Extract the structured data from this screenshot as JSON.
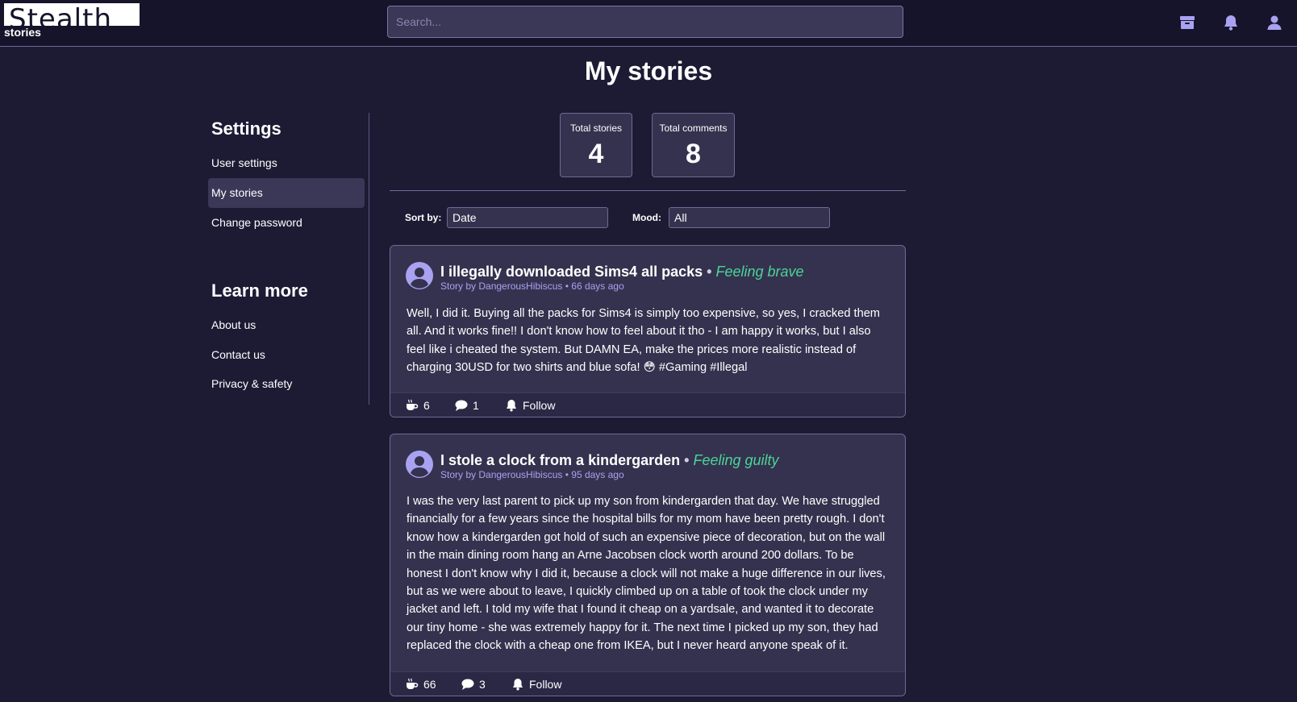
{
  "header": {
    "logo_word": "Stealth",
    "logo_sub": "stories",
    "search_placeholder": "Search...",
    "icons": [
      "archive-icon",
      "bell-icon",
      "user-icon"
    ]
  },
  "page": {
    "title": "My stories"
  },
  "sidebar": {
    "settings_heading": "Settings",
    "settings_items": [
      {
        "label": "User settings",
        "active": false
      },
      {
        "label": "My stories",
        "active": true
      },
      {
        "label": "Change password",
        "active": false
      }
    ],
    "learn_heading": "Learn more",
    "learn_items": [
      {
        "label": "About us"
      },
      {
        "label": "Contact us"
      },
      {
        "label": "Privacy & safety"
      }
    ]
  },
  "stats": {
    "total_stories_label": "Total stories",
    "total_stories": "4",
    "total_comments_label": "Total comments",
    "total_comments": "8"
  },
  "filters": {
    "sort_label": "Sort by:",
    "sort_value": "Date",
    "mood_label": "Mood:",
    "mood_value": "All"
  },
  "stories": [
    {
      "title": "I illegally downloaded Sims4 all packs",
      "separator": "•",
      "mood": "Feeling brave",
      "meta": "Story by DangerousHibiscus • 66 days ago",
      "body": "Well, I did it. Buying all the packs for Sims4 is simply too expensive, so yes, I cracked them all. And it works fine!! I don't know how to feel about it tho - I am happy it works, but I also feel like i cheated the system. But DAMN EA, make the prices more realistic instead of charging 30USD for two shirts and blue sofa! 😳 #Gaming #Illegal",
      "likes": "6",
      "comments": "1",
      "follow": "Follow"
    },
    {
      "title": "I stole a clock from a kindergarden",
      "separator": "•",
      "mood": "Feeling guilty",
      "meta": "Story by DangerousHibiscus • 95 days ago",
      "body": "I was the very last parent to pick up my son from kindergarden that day. We have struggled financially for a few years since the hospital bills for my mom have been pretty rough. I don't know how a kindergarden got hold of such an expensive piece of decoration, but on the wall in the main dining room hang an Arne Jacobsen clock worth around 200 dollars. To be honest I don't know why I did it, because a clock will not make a huge difference in our lives, but as we were about to leave, I quickly climbed up on a table of took the clock under my jacket and left. I told my wife that I found it cheap on a yardsale, and wanted it to decorate our tiny home - she was extremely happy for it. The next time I picked up my son, they had replaced the clock with a cheap one from IKEA, but I never heard anyone speak of it.",
      "likes": "66",
      "comments": "3",
      "follow": "Follow"
    }
  ],
  "colors": {
    "background": "#1d1b34",
    "header": "#15142a",
    "card": "#35324f",
    "accent_purple": "#a9a2f0",
    "mood_green": "#4bd496"
  }
}
